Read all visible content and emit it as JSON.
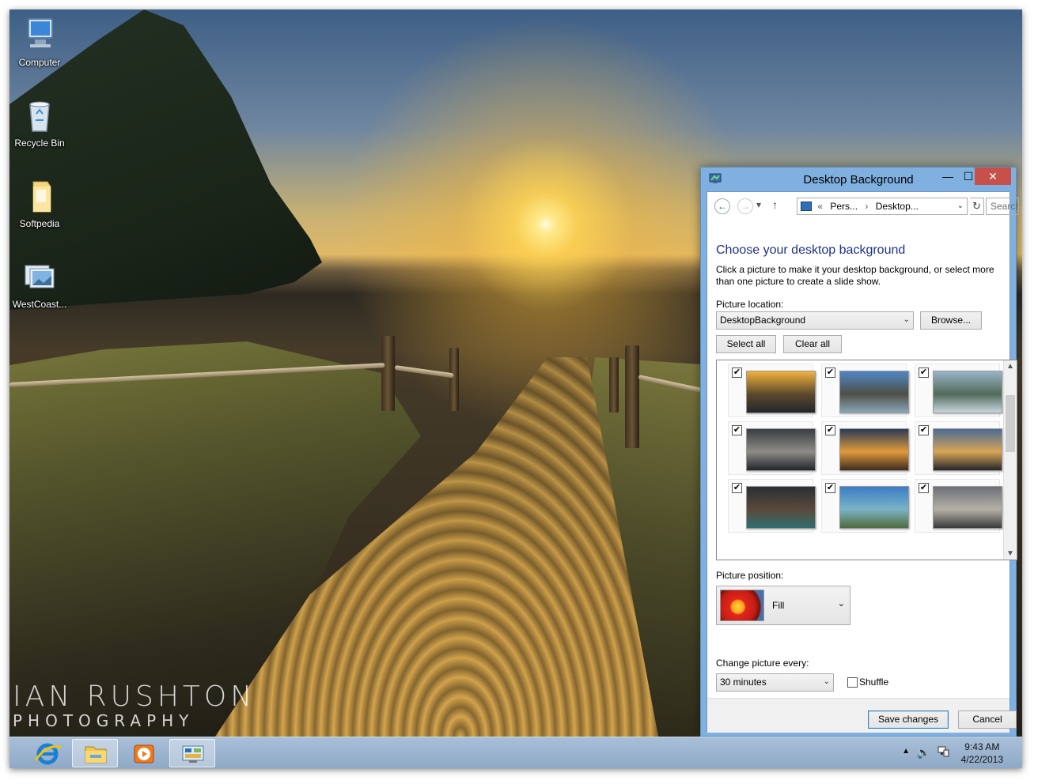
{
  "desktop": {
    "icons": [
      {
        "label": "Computer",
        "icon": "computer-icon"
      },
      {
        "label": "Recycle Bin",
        "icon": "recycle-bin-icon"
      },
      {
        "label": "Softpedia",
        "icon": "folder-icon"
      },
      {
        "label": "WestCoast...",
        "icon": "theme-pack-icon"
      }
    ],
    "wallpaper_watermark": {
      "line1": "IAN RUSHTON",
      "line2": "PHOTOGRAPHY"
    }
  },
  "window": {
    "title": "Desktop Background",
    "controls": {
      "minimize": "—",
      "maximize": "☐",
      "close": "✕"
    },
    "nav": {
      "back": "←",
      "forward": "→",
      "recent": "▾",
      "up": "↑",
      "address_prefix": "«",
      "breadcrumb": [
        "Pers...",
        "Desktop..."
      ],
      "refresh": "↻",
      "search_placeholder": "Search"
    },
    "heading": "Choose your desktop background",
    "description": "Click a picture to make it your desktop background, or select more than one picture to create a slide show.",
    "picture_location_label": "Picture location:",
    "picture_location_value": "DesktopBackground",
    "browse_label": "Browse...",
    "select_all_label": "Select all",
    "clear_all_label": "Clear all",
    "thumbnails": [
      {
        "checked": true,
        "check_glyph": "✔",
        "colors": [
          "#f2b13c",
          "#5d4a2c",
          "#23252b"
        ]
      },
      {
        "checked": true,
        "check_glyph": "✔",
        "colors": [
          "#4f86c6",
          "#4f4f46",
          "#8aa7b8"
        ]
      },
      {
        "checked": true,
        "check_glyph": "✔",
        "colors": [
          "#9ab4c8",
          "#506a5a",
          "#c8d6dd"
        ]
      },
      {
        "checked": true,
        "check_glyph": "✔",
        "colors": [
          "#3a3d42",
          "#8d8c86",
          "#22252a"
        ]
      },
      {
        "checked": true,
        "check_glyph": "✔",
        "colors": [
          "#2a3b56",
          "#e09a3c",
          "#3d2b1f"
        ]
      },
      {
        "checked": true,
        "check_glyph": "✔",
        "colors": [
          "#4a6a94",
          "#d8a656",
          "#23262a"
        ]
      },
      {
        "checked": true,
        "check_glyph": "✔",
        "colors": [
          "#2a2f33",
          "#5a4a3c",
          "#2f6e6e"
        ]
      },
      {
        "checked": true,
        "check_glyph": "✔",
        "colors": [
          "#3b7ec9",
          "#7ab3c4",
          "#4f6b3e"
        ]
      },
      {
        "checked": true,
        "check_glyph": "✔",
        "colors": [
          "#6e7078",
          "#b5b1a6",
          "#3a3a3c"
        ]
      }
    ],
    "picture_position_label": "Picture position:",
    "picture_position_value": "Fill",
    "change_picture_label": "Change picture every:",
    "change_picture_value": "30 minutes",
    "shuffle_label": "Shuffle",
    "shuffle_checked": false,
    "save_label": "Save changes",
    "cancel_label": "Cancel"
  },
  "taskbar": {
    "apps": [
      {
        "name": "internet-explorer-icon",
        "active": false
      },
      {
        "name": "file-explorer-icon",
        "active": false
      },
      {
        "name": "media-player-icon",
        "active": false
      },
      {
        "name": "control-panel-icon",
        "active": true
      }
    ],
    "tray_icons": [
      "show-hidden-icons-icon",
      "volume-icon",
      "network-icon"
    ],
    "time": "9:43 AM",
    "date": "4/22/2013"
  },
  "colors": {
    "accent": "#1e3287",
    "window_frame": "#7fb0df",
    "close_button": "#c7504a",
    "taskbar": "#9bb4cf"
  }
}
